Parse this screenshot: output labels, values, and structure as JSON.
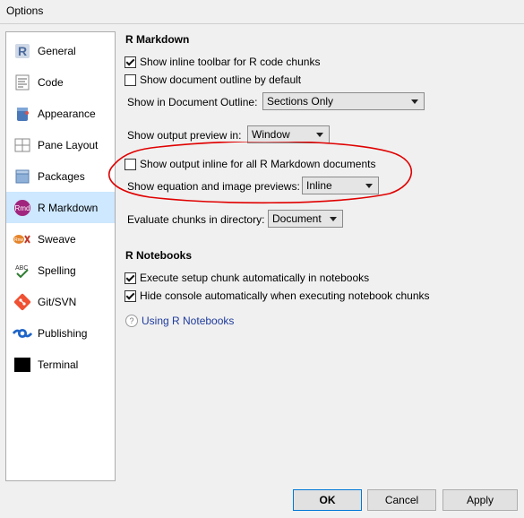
{
  "window": {
    "title": "Options"
  },
  "sidebar": {
    "items": [
      {
        "label": "General",
        "icon": "r-logo-icon"
      },
      {
        "label": "Code",
        "icon": "code-doc-icon"
      },
      {
        "label": "Appearance",
        "icon": "paint-bucket-icon"
      },
      {
        "label": "Pane Layout",
        "icon": "pane-layout-icon"
      },
      {
        "label": "Packages",
        "icon": "package-box-icon"
      },
      {
        "label": "R Markdown",
        "icon": "rmd-icon",
        "active": true
      },
      {
        "label": "Sweave",
        "icon": "sweave-icon"
      },
      {
        "label": "Spelling",
        "icon": "spellcheck-icon"
      },
      {
        "label": "Git/SVN",
        "icon": "git-icon"
      },
      {
        "label": "Publishing",
        "icon": "publishing-icon"
      },
      {
        "label": "Terminal",
        "icon": "terminal-icon"
      }
    ]
  },
  "rmarkdown": {
    "heading": "R Markdown",
    "show_inline_toolbar": {
      "label": "Show inline toolbar for R code chunks",
      "checked": true
    },
    "show_outline_default": {
      "label": "Show document outline by default",
      "checked": false
    },
    "doc_outline": {
      "label": "Show in Document Outline:",
      "value": "Sections Only"
    },
    "output_preview": {
      "label": "Show output preview in:",
      "value": "Window"
    },
    "output_inline": {
      "label": "Show output inline for all R Markdown documents",
      "checked": false
    },
    "eq_previews": {
      "label": "Show equation and image previews:",
      "value": "Inline"
    },
    "eval_dir": {
      "label": "Evaluate chunks in directory:",
      "value": "Document"
    }
  },
  "notebooks": {
    "heading": "R Notebooks",
    "exec_setup": {
      "label": "Execute setup chunk automatically in notebooks",
      "checked": true
    },
    "hide_console": {
      "label": "Hide console automatically when executing notebook chunks",
      "checked": true
    },
    "help_link": "Using R Notebooks",
    "help_icon_glyph": "?"
  },
  "footer": {
    "ok": "OK",
    "cancel": "Cancel",
    "apply": "Apply"
  },
  "colors": {
    "highlight": "#cde8ff",
    "annotation": "#e00000",
    "link": "#1f3b9c"
  }
}
